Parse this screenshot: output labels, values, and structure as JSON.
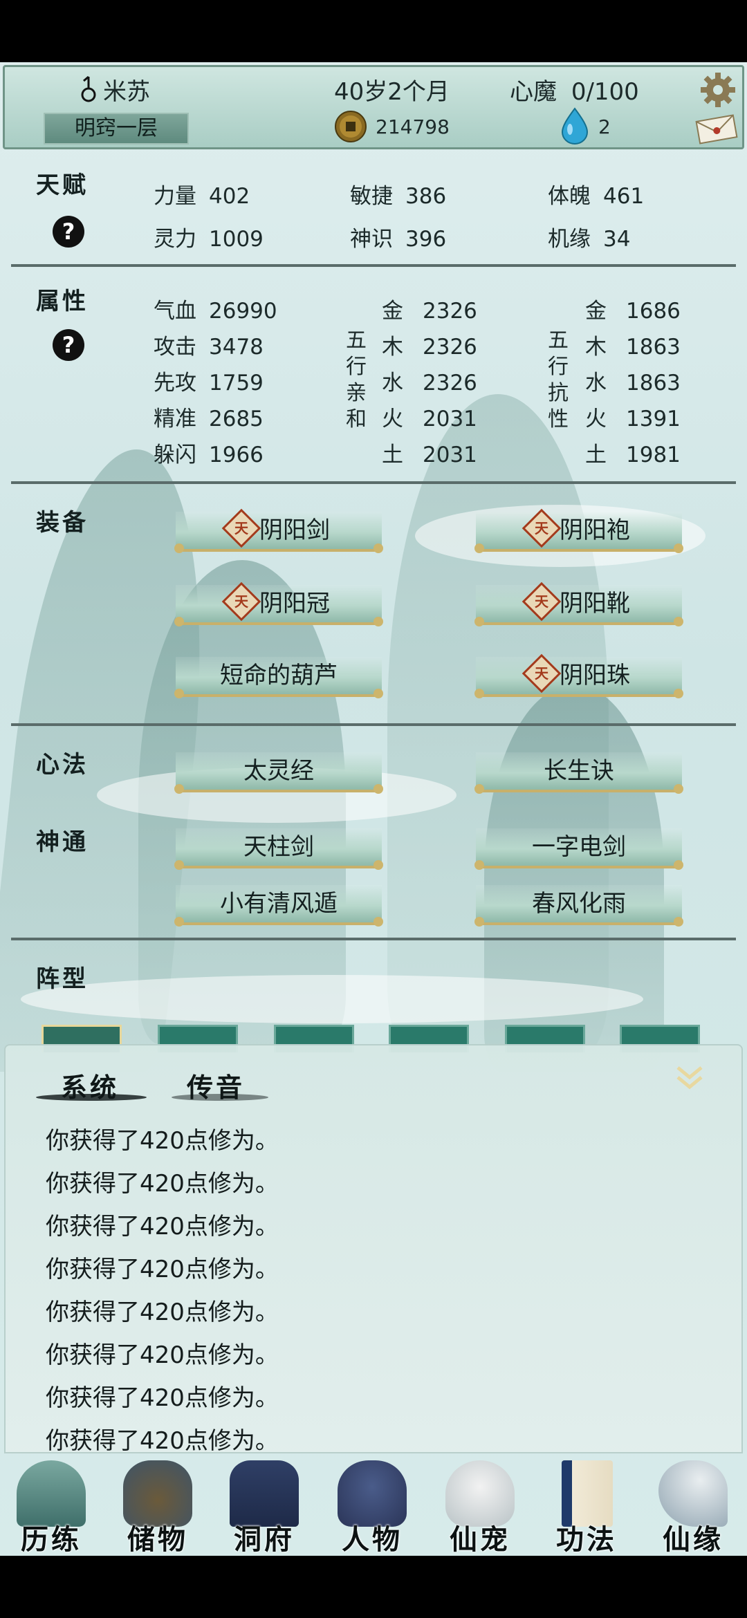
{
  "header": {
    "name": "米苏",
    "realm": "明窍一层",
    "age": "40岁2个月",
    "heart_demon_label": "心魔",
    "heart_demon_value": "0/100",
    "coins": "214798",
    "gems": "2"
  },
  "talent": {
    "label": "天赋",
    "help": "?",
    "stats": [
      {
        "k": "力量",
        "v": "402"
      },
      {
        "k": "敏捷",
        "v": "386"
      },
      {
        "k": "体魄",
        "v": "461"
      },
      {
        "k": "灵力",
        "v": "1009"
      },
      {
        "k": "神识",
        "v": "396"
      },
      {
        "k": "机缘",
        "v": "34"
      }
    ]
  },
  "attributes": {
    "label": "属性",
    "help": "?",
    "base": [
      {
        "k": "气血",
        "v": "26990"
      },
      {
        "k": "攻击",
        "v": "3478"
      },
      {
        "k": "先攻",
        "v": "1759"
      },
      {
        "k": "精准",
        "v": "2685"
      },
      {
        "k": "躲闪",
        "v": "1966"
      }
    ],
    "affinity_label": [
      "五",
      "行",
      "亲",
      "和"
    ],
    "affinity": [
      {
        "k": "金",
        "v": "2326"
      },
      {
        "k": "木",
        "v": "2326"
      },
      {
        "k": "水",
        "v": "2326"
      },
      {
        "k": "火",
        "v": "2031"
      },
      {
        "k": "土",
        "v": "2031"
      }
    ],
    "resist_label": [
      "五",
      "行",
      "抗",
      "性"
    ],
    "resist": [
      {
        "k": "金",
        "v": "1686"
      },
      {
        "k": "木",
        "v": "1863"
      },
      {
        "k": "水",
        "v": "1863"
      },
      {
        "k": "火",
        "v": "1391"
      },
      {
        "k": "土",
        "v": "1981"
      }
    ]
  },
  "equipment": {
    "label": "装备",
    "tier_badge": "天",
    "items": [
      "阴阳剑",
      "阴阳袍",
      "阴阳冠",
      "阴阳靴",
      "短命的葫芦",
      "阴阳珠"
    ]
  },
  "mind_methods": {
    "label": "心法",
    "items": [
      "太灵经",
      "长生诀"
    ]
  },
  "skills": {
    "label": "神通",
    "items": [
      "天柱剑",
      "一字电剑",
      "小有清风遁",
      "春风化雨"
    ]
  },
  "formation": {
    "label": "阵型"
  },
  "chat": {
    "tabs": [
      "系统",
      "传音"
    ],
    "messages": [
      "你获得了420点修为。",
      "你获得了420点修为。",
      "你获得了420点修为。",
      "你获得了420点修为。",
      "你获得了420点修为。",
      "你获得了420点修为。",
      "你获得了420点修为。",
      "你获得了420点修为。"
    ]
  },
  "nav": {
    "items": [
      "历练",
      "储物",
      "洞府",
      "人物",
      "仙宠",
      "功法",
      "仙缘"
    ],
    "active": "人物"
  },
  "colors": {
    "accent_green": "#2a7a6a",
    "gold_trim": "#c8b06a",
    "tier_red": "#a33a1c"
  }
}
